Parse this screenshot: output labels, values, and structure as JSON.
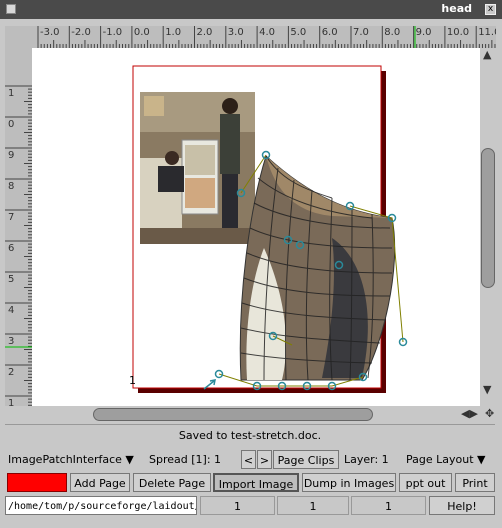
{
  "window": {
    "title": "head",
    "close_glyph": "x"
  },
  "rulers": {
    "horizontal_labels": [
      "-3.0",
      "-2.0",
      "-1.0",
      "0.0",
      "1.0",
      "2.0",
      "3.0",
      "4.0",
      "5.0",
      "6.0",
      "7.0",
      "8.0",
      "9.0",
      "10.0",
      "11.0"
    ],
    "vertical_labels": [
      "1",
      "0",
      "9",
      "8",
      "7",
      "6",
      "5",
      "4",
      "3",
      "2",
      "1",
      "0"
    ]
  },
  "canvas": {
    "page_number_label": "1"
  },
  "status": {
    "message": "Saved to test-stretch.doc."
  },
  "toolbar1": {
    "interface_menu": "ImagePatchInterface",
    "spread_label": "Spread [1]: 1",
    "prev_glyph": "<",
    "next_glyph": ">",
    "page_clips": "Page Clips",
    "layer_label": "Layer: 1",
    "page_layout_menu": "Page Layout",
    "menu_arrow": "▼"
  },
  "toolbar2": {
    "color_swatch": "#ff0000",
    "add_page": "Add Page",
    "delete_page": "Delete Page",
    "import_image": "Import Image",
    "dump_in_images": "Dump in Images",
    "ppt_out": "ppt out",
    "print": "Print"
  },
  "bottombar": {
    "path_value": "/home/tom/p/sourceforge/laidout/",
    "field1": "1",
    "field2": "1",
    "field3": "1",
    "help": "Help!"
  }
}
